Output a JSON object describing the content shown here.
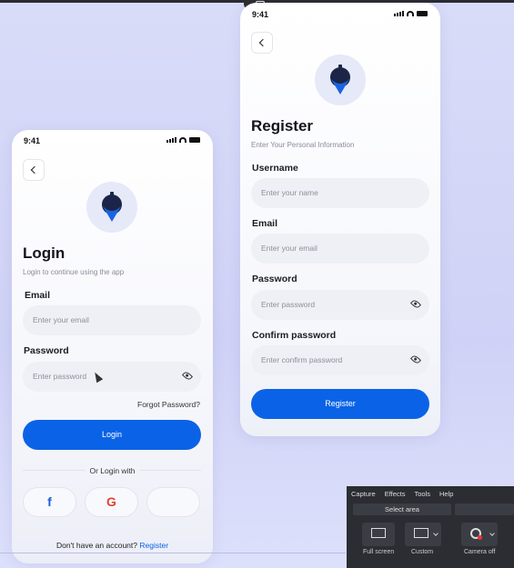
{
  "login": {
    "status_time": "9:41",
    "title": "Login",
    "subtitle": "Login to continue using the app",
    "email_label": "Email",
    "email_placeholder": "Enter your email",
    "password_label": "Password",
    "password_placeholder": "Enter password",
    "forgot_label": "Forgot Password?",
    "login_button": "Login",
    "divider": "Or Login with",
    "social": [
      "f",
      "G",
      ""
    ],
    "no_account": "Don't have an account?",
    "register_link": "Register"
  },
  "register": {
    "status_time": "9:41",
    "title": "Register",
    "subtitle": "Enter Your Personal Information",
    "username_label": "Username",
    "username_placeholder": "Enter your name",
    "email_label": "Email",
    "email_placeholder": "Enter your email",
    "password_label": "Password",
    "password_placeholder": "Enter password",
    "confirm_label": "Confirm password",
    "confirm_placeholder": "Enter confirm password",
    "register_button": "Register"
  },
  "capture_tool": {
    "menu": [
      "Capture",
      "Effects",
      "Tools",
      "Help"
    ],
    "select_area": "Select area",
    "full_screen": "Full screen",
    "custom": "Custom",
    "camera_off": "Camera off"
  },
  "colors": {
    "accent": "#0a63e6",
    "field_bg": "#eef0f6",
    "background": "#d4d7f7"
  }
}
